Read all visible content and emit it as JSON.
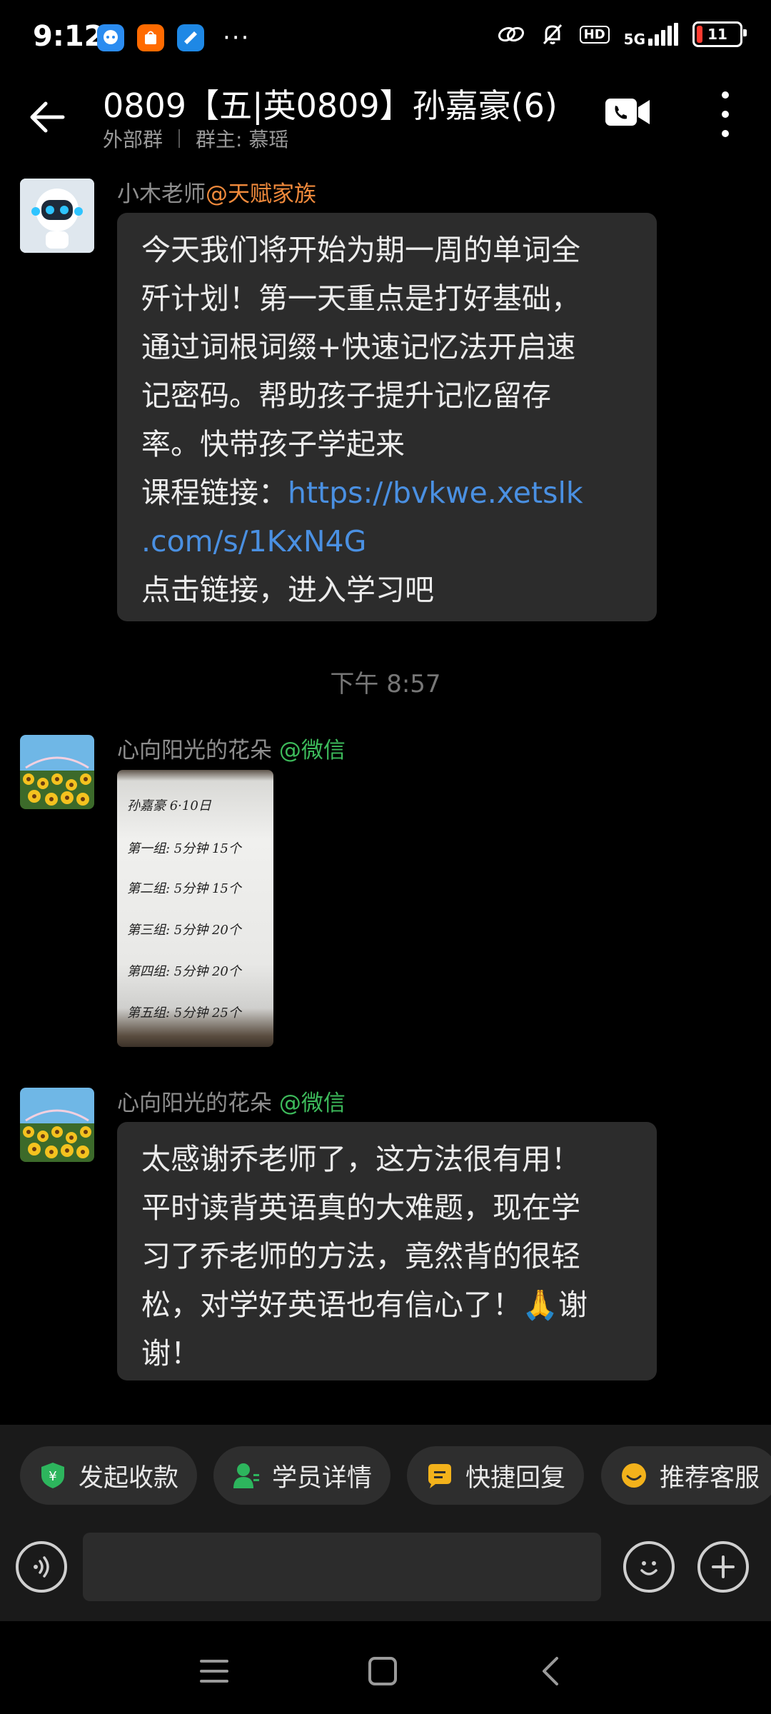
{
  "status_bar": {
    "time": "9:12",
    "network": "5G",
    "hd": "HD",
    "battery": "11"
  },
  "header": {
    "title": "0809【五|英0809】孙嘉豪(6)",
    "group_type": "外部群",
    "group_owner": "群主: 慕瑶"
  },
  "messages": [
    {
      "sender": "小木老师",
      "mention": "@天赋家族",
      "lines": [
        "今天我们将开始为期一周的单词全",
        "歼计划！第一天重点是打好基础，",
        "通过词根词缀+快速记忆法开启速",
        "记密码。帮助孩子提升记忆留存",
        "率。快带孩子学起来"
      ],
      "link_prefix": "课程链接：",
      "link_part1": "https://bvkwe.xetslk",
      "link_part2": ".com/s/1KxN4G",
      "footer": "点击链接，进入学习吧"
    },
    {
      "sender": "心向阳光的花朵",
      "mention": "@微信",
      "image_text": [
        "孙嘉豪 6·10日",
        "第一组: 5分钟 15个",
        "第二组: 5分钟 15个",
        "第三组: 5分钟 20个",
        "第四组: 5分钟 20个",
        "第五组: 5分钟 25个"
      ]
    },
    {
      "sender": "心向阳光的花朵",
      "mention": "@微信",
      "lines": [
        "太感谢乔老师了，这方法很有用！",
        "平时读背英语真的大难题，现在学",
        "习了乔老师的方法，竟然背的很轻",
        "松，对学好英语也有信心了！🙏谢",
        "谢！"
      ]
    }
  ],
  "timestamp": "下午 8:57",
  "quick_actions": [
    "发起收款",
    "学员详情",
    "快捷回复",
    "推荐客服"
  ],
  "colors": {
    "mention_orange": "#f08a3c",
    "mention_green": "#3dbb5b",
    "link_blue": "#4a90e2",
    "bubble_bg": "#2c2c2c"
  }
}
